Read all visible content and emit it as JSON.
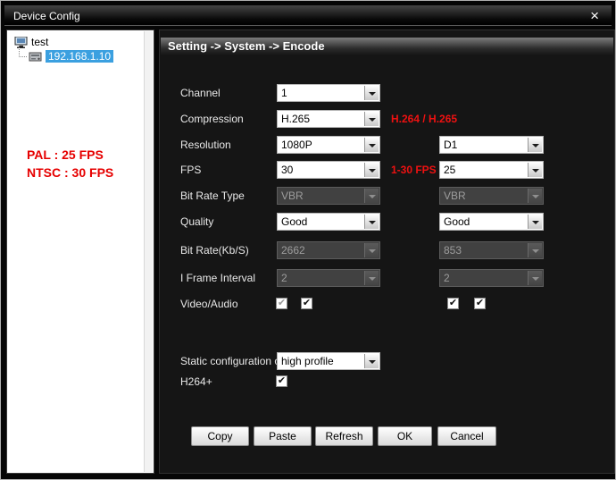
{
  "window": {
    "title": "Device Config",
    "close_glyph": "×"
  },
  "tree": {
    "root_label": "test",
    "device_label": "192.168.1.10",
    "device_selected": true,
    "note_pal": "PAL : 25 FPS",
    "note_ntsc": "NTSC : 30 FPS"
  },
  "panel": {
    "header": "Setting -> System -> Encode"
  },
  "form": {
    "channel": {
      "label": "Channel",
      "value": "1"
    },
    "compression": {
      "label": "Compression",
      "value": "H.265",
      "annotation": "H.264 / H.265"
    },
    "resolution": {
      "label": "Resolution",
      "value": "1080P",
      "value2": "D1"
    },
    "fps": {
      "label": "FPS",
      "value": "30",
      "annotation": "1-30 FPS",
      "value2": "25"
    },
    "bit_rate_type": {
      "label": "Bit Rate Type",
      "value": "VBR",
      "value2": "VBR",
      "disabled": true
    },
    "quality": {
      "label": "Quality",
      "value": "Good",
      "value2": "Good"
    },
    "bit_rate": {
      "label": "Bit Rate(Kb/S)",
      "value": "2662",
      "value2": "853",
      "disabled": true
    },
    "i_frame_interval": {
      "label": "I Frame Interval",
      "value": "2",
      "value2": "2",
      "disabled": true
    },
    "video_audio": {
      "label": "Video/Audio",
      "main_video_checked": true,
      "main_audio_checked": true,
      "sub_video_checked": true,
      "sub_audio_checked": true
    },
    "static_config": {
      "label": "Static configuration of",
      "value": "high profile"
    },
    "h264_plus": {
      "label": "H264+",
      "checked": true
    }
  },
  "buttons": {
    "copy": "Copy",
    "paste": "Paste",
    "refresh": "Refresh",
    "ok": "OK",
    "cancel": "Cancel"
  },
  "ui": {
    "check": "✔"
  },
  "colors": {
    "accent_red": "#e60000",
    "selection_blue": "#3ba0e0",
    "panel_dark": "#151515"
  }
}
